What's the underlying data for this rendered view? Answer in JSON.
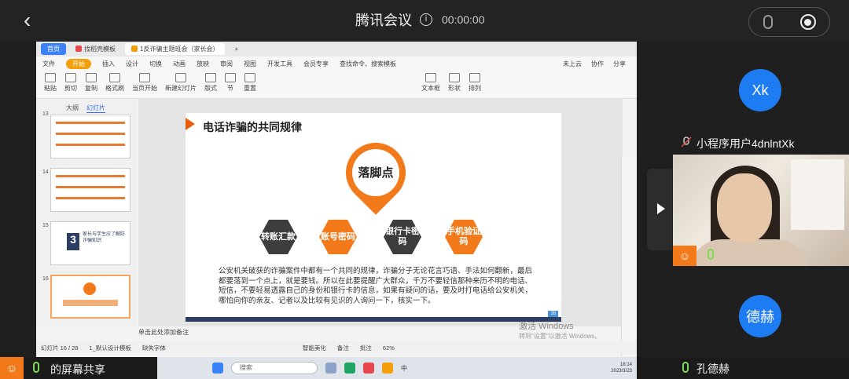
{
  "meeting": {
    "title": "腾讯会议",
    "timer": "00:00:00"
  },
  "wps": {
    "tabs": [
      "首页",
      "找稻壳模板",
      "1反诈骗主题班会（家长会）"
    ],
    "menu": [
      "文件",
      "开始",
      "插入",
      "设计",
      "切换",
      "动画",
      "放映",
      "审阅",
      "视图",
      "开发工具",
      "会员专享"
    ],
    "search_placeholder": "查找命令、搜索模板",
    "menu_right": [
      "未上云",
      "协作",
      "分享"
    ],
    "toolbar": [
      "粘贴",
      "剪切",
      "复制",
      "格式刷",
      "当页开始",
      "新建幻灯片",
      "版式",
      "节",
      "重置",
      "文本框",
      "形状",
      "排列"
    ],
    "outline_tabs": [
      "大纲",
      "幻灯片"
    ],
    "thumb_numbers": [
      "13",
      "14",
      "15",
      "16"
    ],
    "thumb15_title": "家长与学生应了解防诈骗知识",
    "notes_placeholder": "单击此处添加备注",
    "status": {
      "page": "幻灯片 16 / 28",
      "theme": "1_默认设计模板",
      "font": "缺失字体",
      "smart": "智能美化",
      "notes": "备注",
      "comments": "批注",
      "zoom": "62%"
    },
    "watermark": {
      "line1": "激活 Windows",
      "line2": "转到\"设置\"以激活 Windows。"
    },
    "taskbar": {
      "search": "搜索",
      "time": "18:14",
      "date": "2023/3/23",
      "lang": "中"
    }
  },
  "slide": {
    "title": "电话诈骗的共同规律",
    "pin_text": "落脚点",
    "hexagons": [
      {
        "label": "转账汇款",
        "style": "dark"
      },
      {
        "label": "账号密码",
        "style": "orange"
      },
      {
        "label": "银行卡密码",
        "style": "dark"
      },
      {
        "label": "手机验证码",
        "style": "orange"
      }
    ],
    "body": "公安机关破获的诈骗案件中都有一个共同的规律，诈骗分子无论花言巧语、手法如何翻新，最后都要落到一个点上，就是要钱。所以在此要提醒广大群众，千万不要轻信那种来历不明的电话、短信，不要轻易透露自己的身份和银行卡的信息，如果有疑问的话，要及时打电话给公安机关，哪怕向你的亲友、记者以及比较有见识的人询问一下，核实一下。",
    "page_badge": "16"
  },
  "participants": [
    {
      "avatar": "Xk",
      "name": "小程序用户4dnlntXk"
    },
    {
      "avatar": "德赫",
      "name": "孔德赫"
    }
  ],
  "bottom": {
    "share_label": "的屏幕共享"
  },
  "colors": {
    "accent": "#f27a1a",
    "avatar_blue": "#1e7cf2",
    "mic_green": "#7ed957"
  }
}
